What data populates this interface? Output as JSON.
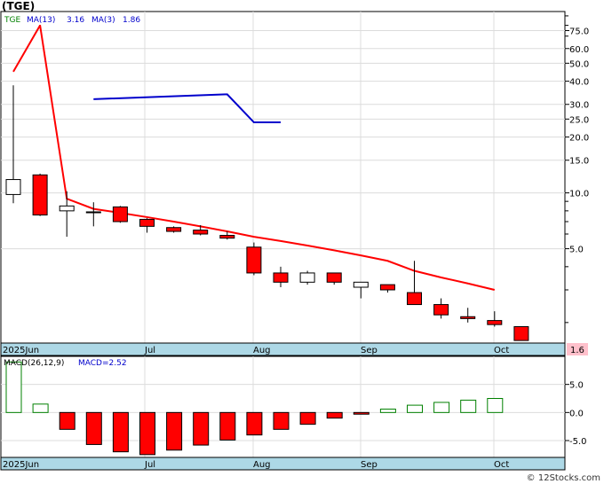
{
  "ticker_title": "(TGE)",
  "legend": {
    "symbol": "TGE",
    "ma13_label": "MA(13)",
    "ma13_value": "3.16",
    "ma3_label": "MA(3)",
    "ma3_value": "1.86"
  },
  "macd_legend": {
    "label": "MACD(26,12,9)",
    "value_label": "MACD=2.52"
  },
  "last_price_label": "1.6",
  "footer": "© 12Stocks.com",
  "colors": {
    "up": "#ffffff",
    "down": "#ff0000",
    "ma13": "#ff0000",
    "ma3": "#0000cc",
    "axis_band": "#add8e6",
    "price_tag": "#ffc0cb",
    "legend_text": "#0000cc",
    "symbol_text": "#008000"
  },
  "chart_data": [
    {
      "type": "candlestick",
      "scale": "log",
      "y_ticks": [
        75,
        60,
        50,
        40,
        30,
        25,
        20,
        15,
        10,
        5
      ],
      "y_tick_labels": [
        "75.0",
        "60.0",
        "50.0",
        "40.0",
        "30.0",
        "25.0",
        "20.0",
        "15.0",
        "10.0",
        "5.0"
      ],
      "x_labels": [
        "2025Jun",
        "Jul",
        "Aug",
        "Sep",
        "Oct"
      ],
      "candles": [
        {
          "o": 9.8,
          "h": 38.0,
          "l": 8.8,
          "c": 11.8
        },
        {
          "o": 12.5,
          "h": 12.7,
          "l": 7.5,
          "c": 7.6
        },
        {
          "o": 8.0,
          "h": 10.2,
          "l": 5.8,
          "c": 8.5
        },
        {
          "o": 7.9,
          "h": 8.9,
          "l": 6.6,
          "c": 7.9
        },
        {
          "o": 8.4,
          "h": 8.5,
          "l": 6.9,
          "c": 7.0
        },
        {
          "o": 7.2,
          "h": 7.3,
          "l": 6.1,
          "c": 6.6
        },
        {
          "o": 6.5,
          "h": 6.6,
          "l": 6.1,
          "c": 6.2
        },
        {
          "o": 6.3,
          "h": 6.7,
          "l": 5.9,
          "c": 6.0
        },
        {
          "o": 5.9,
          "h": 6.2,
          "l": 5.6,
          "c": 5.7
        },
        {
          "o": 5.1,
          "h": 5.4,
          "l": 3.6,
          "c": 3.7
        },
        {
          "o": 3.7,
          "h": 4.0,
          "l": 3.1,
          "c": 3.3
        },
        {
          "o": 3.3,
          "h": 3.8,
          "l": 3.2,
          "c": 3.7
        },
        {
          "o": 3.7,
          "h": 3.7,
          "l": 3.2,
          "c": 3.3
        },
        {
          "o": 3.1,
          "h": 3.3,
          "l": 2.7,
          "c": 3.3
        },
        {
          "o": 3.2,
          "h": 3.2,
          "l": 2.9,
          "c": 3.0
        },
        {
          "o": 2.9,
          "h": 4.3,
          "l": 2.5,
          "c": 2.5
        },
        {
          "o": 2.5,
          "h": 2.7,
          "l": 2.1,
          "c": 2.2
        },
        {
          "o": 2.15,
          "h": 2.4,
          "l": 2.0,
          "c": 2.1
        },
        {
          "o": 2.05,
          "h": 2.3,
          "l": 1.9,
          "c": 1.95
        },
        {
          "o": 1.9,
          "h": 1.9,
          "l": 1.6,
          "c": 1.6
        }
      ],
      "ma13": [
        45,
        80,
        9.3,
        8.2,
        7.8,
        7.4,
        7.0,
        6.6,
        6.2,
        5.8,
        5.5,
        5.2,
        4.9,
        4.6,
        4.3,
        3.8,
        3.5,
        3.25,
        3.0,
        2.8,
        2.6
      ],
      "ma13_x": [
        0,
        1,
        2,
        3,
        4,
        5,
        6,
        7,
        8,
        9,
        10,
        11,
        12,
        13,
        14,
        15,
        16,
        17,
        18,
        19
      ],
      "ma3_x": [
        3,
        8,
        9,
        10
      ],
      "ma3": [
        32,
        34,
        24,
        24
      ]
    },
    {
      "type": "bar",
      "title": "MACD(26,12,9)",
      "y_ticks": [
        5.0,
        0.0,
        -5.0
      ],
      "y_tick_labels": [
        "5.0",
        "0.0",
        "-5.0"
      ],
      "x_labels": [
        "2025Jun",
        "Jul",
        "Aug",
        "Sep",
        "Oct"
      ],
      "values": [
        9.0,
        1.5,
        -3.0,
        -5.7,
        -7.0,
        -7.5,
        -6.7,
        -5.8,
        -4.9,
        -4.0,
        -3.0,
        -2.1,
        -1.0,
        -0.3,
        0.6,
        1.3,
        1.8,
        2.2,
        2.5
      ]
    }
  ]
}
